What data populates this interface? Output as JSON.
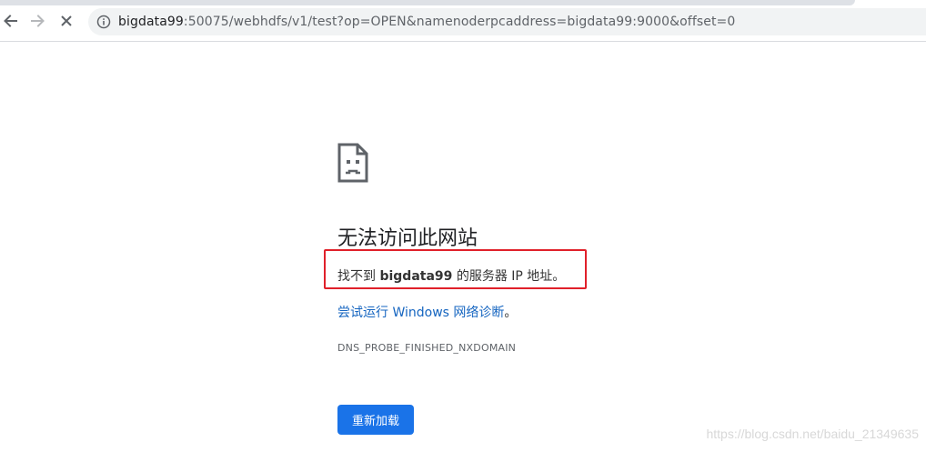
{
  "browser": {
    "url_host": "bigdata99",
    "url_rest": ":50075/webhdfs/v1/test?op=OPEN&namenoderpcaddress=bigdata99:9000&offset=0",
    "icons": {
      "back": "back-arrow-icon",
      "forward": "forward-arrow-icon",
      "stop": "stop-loading-icon",
      "info": "site-info-icon"
    }
  },
  "error": {
    "icon": "sad-page-icon",
    "title": "无法访问此网站",
    "detail_prefix": "找不到 ",
    "detail_host": "bigdata99",
    "detail_suffix": " 的服务器 IP 地址。",
    "suggest_link": "尝试运行 Windows 网络诊断",
    "suggest_end": "。",
    "code": "DNS_PROBE_FINISHED_NXDOMAIN",
    "reload_label": "重新加载"
  },
  "annotation": {
    "highlight_color": "#e0202a"
  },
  "watermark": "https://blog.csdn.net/baidu_21349635",
  "colors": {
    "accent": "#1a73e8",
    "link": "#1565c0"
  }
}
